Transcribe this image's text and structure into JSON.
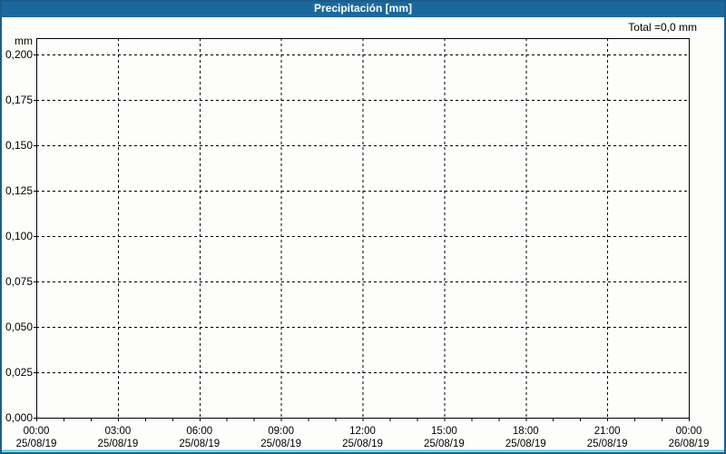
{
  "window": {
    "title": "Precipitación [mm]"
  },
  "colors": {
    "titlebar_bg": "#1b689e",
    "titlebar_text": "#ffffff",
    "window_border": "#1d5c8c",
    "bottom_accent": "#4ec1ea",
    "background": "#fdfefb",
    "grid": "#000000",
    "axis": "#000000",
    "text": "#000000"
  },
  "chart_data": {
    "type": "bar",
    "title": "Precipitación [mm]",
    "ylabel": "mm",
    "total_label": "Total =0,0 mm",
    "ylim": [
      0,
      0.209
    ],
    "xlim_hours": [
      0,
      24
    ],
    "grid": "dashed",
    "x_minor_tick_hours": 1,
    "x_major_tick_hours": 3,
    "y_ticks": [
      {
        "value": 0.2,
        "label": "0,200"
      },
      {
        "value": 0.175,
        "label": "0,175"
      },
      {
        "value": 0.15,
        "label": "0,150"
      },
      {
        "value": 0.125,
        "label": "0,125"
      },
      {
        "value": 0.1,
        "label": "0,100"
      },
      {
        "value": 0.075,
        "label": "0,075"
      },
      {
        "value": 0.05,
        "label": "0,050"
      },
      {
        "value": 0.025,
        "label": "0,025"
      },
      {
        "value": 0.0,
        "label": "0,000"
      }
    ],
    "x_ticks": [
      {
        "hour": 0,
        "time": "00:00",
        "date": "25/08/19"
      },
      {
        "hour": 3,
        "time": "03:00",
        "date": "25/08/19"
      },
      {
        "hour": 6,
        "time": "06:00",
        "date": "25/08/19"
      },
      {
        "hour": 9,
        "time": "09:00",
        "date": "25/08/19"
      },
      {
        "hour": 12,
        "time": "12:00",
        "date": "25/08/19"
      },
      {
        "hour": 15,
        "time": "15:00",
        "date": "25/08/19"
      },
      {
        "hour": 18,
        "time": "18:00",
        "date": "25/08/19"
      },
      {
        "hour": 21,
        "time": "21:00",
        "date": "25/08/19"
      },
      {
        "hour": 24,
        "time": "00:00",
        "date": "26/08/19"
      }
    ],
    "series": [
      {
        "name": "Precipitación",
        "values": [],
        "total_mm": 0.0
      }
    ]
  }
}
